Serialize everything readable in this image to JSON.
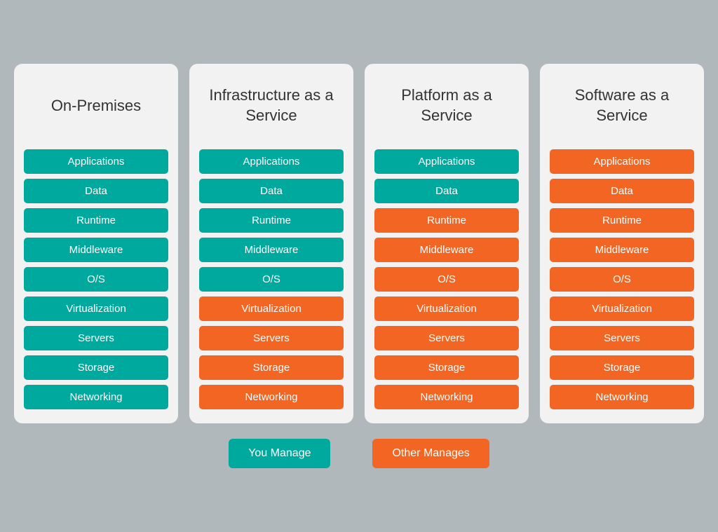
{
  "columns": [
    {
      "id": "on-premises",
      "title": "On-Premises",
      "items": [
        {
          "label": "Applications",
          "color": "teal"
        },
        {
          "label": "Data",
          "color": "teal"
        },
        {
          "label": "Runtime",
          "color": "teal"
        },
        {
          "label": "Middleware",
          "color": "teal"
        },
        {
          "label": "O/S",
          "color": "teal"
        },
        {
          "label": "Virtualization",
          "color": "teal"
        },
        {
          "label": "Servers",
          "color": "teal"
        },
        {
          "label": "Storage",
          "color": "teal"
        },
        {
          "label": "Networking",
          "color": "teal"
        }
      ]
    },
    {
      "id": "infrastructure-as-a-service",
      "title": "Infrastructure as a Service",
      "items": [
        {
          "label": "Applications",
          "color": "teal"
        },
        {
          "label": "Data",
          "color": "teal"
        },
        {
          "label": "Runtime",
          "color": "teal"
        },
        {
          "label": "Middleware",
          "color": "teal"
        },
        {
          "label": "O/S",
          "color": "teal"
        },
        {
          "label": "Virtualization",
          "color": "orange"
        },
        {
          "label": "Servers",
          "color": "orange"
        },
        {
          "label": "Storage",
          "color": "orange"
        },
        {
          "label": "Networking",
          "color": "orange"
        }
      ]
    },
    {
      "id": "platform-as-a-service",
      "title": "Platform as a Service",
      "items": [
        {
          "label": "Applications",
          "color": "teal"
        },
        {
          "label": "Data",
          "color": "teal"
        },
        {
          "label": "Runtime",
          "color": "orange"
        },
        {
          "label": "Middleware",
          "color": "orange"
        },
        {
          "label": "O/S",
          "color": "orange"
        },
        {
          "label": "Virtualization",
          "color": "orange"
        },
        {
          "label": "Servers",
          "color": "orange"
        },
        {
          "label": "Storage",
          "color": "orange"
        },
        {
          "label": "Networking",
          "color": "orange"
        }
      ]
    },
    {
      "id": "software-as-a-service",
      "title": "Software as a Service",
      "items": [
        {
          "label": "Applications",
          "color": "orange"
        },
        {
          "label": "Data",
          "color": "orange"
        },
        {
          "label": "Runtime",
          "color": "orange"
        },
        {
          "label": "Middleware",
          "color": "orange"
        },
        {
          "label": "O/S",
          "color": "orange"
        },
        {
          "label": "Virtualization",
          "color": "orange"
        },
        {
          "label": "Servers",
          "color": "orange"
        },
        {
          "label": "Storage",
          "color": "orange"
        },
        {
          "label": "Networking",
          "color": "orange"
        }
      ]
    }
  ],
  "legend": {
    "you_manage": "You Manage",
    "other_manages": "Other Manages"
  }
}
